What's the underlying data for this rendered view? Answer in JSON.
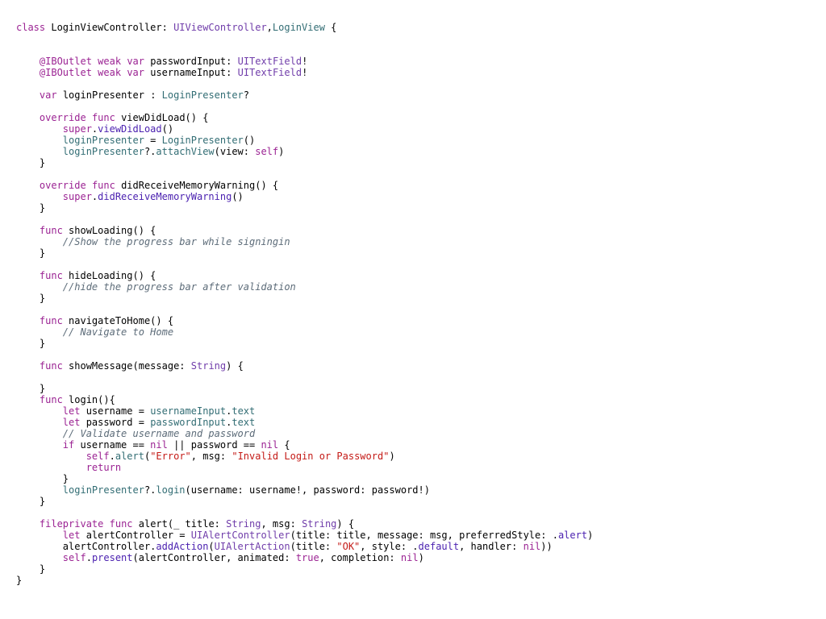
{
  "code": {
    "language": "Swift",
    "lines": [
      [
        [
          "kw",
          "class"
        ],
        [
          "plain",
          " LoginViewController: "
        ],
        [
          "type",
          "UIViewController"
        ],
        [
          "plain",
          ","
        ],
        [
          "ident",
          "LoginView"
        ],
        [
          "plain",
          " {"
        ]
      ],
      [],
      [],
      [
        [
          "plain",
          "    "
        ],
        [
          "attr",
          "@IBOutlet"
        ],
        [
          "plain",
          " "
        ],
        [
          "kw",
          "weak"
        ],
        [
          "plain",
          " "
        ],
        [
          "kw",
          "var"
        ],
        [
          "plain",
          " passwordInput: "
        ],
        [
          "type",
          "UITextField"
        ],
        [
          "plain",
          "!"
        ]
      ],
      [
        [
          "plain",
          "    "
        ],
        [
          "attr",
          "@IBOutlet"
        ],
        [
          "plain",
          " "
        ],
        [
          "kw",
          "weak"
        ],
        [
          "plain",
          " "
        ],
        [
          "kw",
          "var"
        ],
        [
          "plain",
          " usernameInput: "
        ],
        [
          "type",
          "UITextField"
        ],
        [
          "plain",
          "!"
        ]
      ],
      [],
      [
        [
          "plain",
          "    "
        ],
        [
          "kw",
          "var"
        ],
        [
          "plain",
          " loginPresenter : "
        ],
        [
          "ident",
          "LoginPresenter"
        ],
        [
          "plain",
          "?"
        ]
      ],
      [],
      [
        [
          "plain",
          "    "
        ],
        [
          "kw",
          "override"
        ],
        [
          "plain",
          " "
        ],
        [
          "kw",
          "func"
        ],
        [
          "plain",
          " viewDidLoad() {"
        ]
      ],
      [
        [
          "plain",
          "        "
        ],
        [
          "kw",
          "super"
        ],
        [
          "plain",
          "."
        ],
        [
          "call",
          "viewDidLoad"
        ],
        [
          "plain",
          "()"
        ]
      ],
      [
        [
          "plain",
          "        "
        ],
        [
          "ident",
          "loginPresenter"
        ],
        [
          "plain",
          " = "
        ],
        [
          "ident",
          "LoginPresenter"
        ],
        [
          "plain",
          "()"
        ]
      ],
      [
        [
          "plain",
          "        "
        ],
        [
          "ident",
          "loginPresenter"
        ],
        [
          "plain",
          "?."
        ],
        [
          "ident",
          "attachView"
        ],
        [
          "plain",
          "(view: "
        ],
        [
          "kw",
          "self"
        ],
        [
          "plain",
          ")"
        ]
      ],
      [
        [
          "plain",
          "    }"
        ]
      ],
      [],
      [
        [
          "plain",
          "    "
        ],
        [
          "kw",
          "override"
        ],
        [
          "plain",
          " "
        ],
        [
          "kw",
          "func"
        ],
        [
          "plain",
          " didReceiveMemoryWarning() {"
        ]
      ],
      [
        [
          "plain",
          "        "
        ],
        [
          "kw",
          "super"
        ],
        [
          "plain",
          "."
        ],
        [
          "call",
          "didReceiveMemoryWarning"
        ],
        [
          "plain",
          "()"
        ]
      ],
      [
        [
          "plain",
          "    }"
        ]
      ],
      [],
      [
        [
          "plain",
          "    "
        ],
        [
          "kw",
          "func"
        ],
        [
          "plain",
          " showLoading() {"
        ]
      ],
      [
        [
          "plain",
          "        "
        ],
        [
          "comment",
          "//Show the progress bar while signingin"
        ]
      ],
      [
        [
          "plain",
          "    }"
        ]
      ],
      [],
      [
        [
          "plain",
          "    "
        ],
        [
          "kw",
          "func"
        ],
        [
          "plain",
          " hideLoading() {"
        ]
      ],
      [
        [
          "plain",
          "        "
        ],
        [
          "comment",
          "//hide the progress bar after validation"
        ]
      ],
      [
        [
          "plain",
          "    }"
        ]
      ],
      [],
      [
        [
          "plain",
          "    "
        ],
        [
          "kw",
          "func"
        ],
        [
          "plain",
          " navigateToHome() {"
        ]
      ],
      [
        [
          "plain",
          "        "
        ],
        [
          "comment",
          "// Navigate to Home"
        ]
      ],
      [
        [
          "plain",
          "    }"
        ]
      ],
      [],
      [
        [
          "plain",
          "    "
        ],
        [
          "kw",
          "func"
        ],
        [
          "plain",
          " showMessage(message: "
        ],
        [
          "type",
          "String"
        ],
        [
          "plain",
          ") {"
        ]
      ],
      [],
      [
        [
          "plain",
          "    }"
        ]
      ],
      [
        [
          "plain",
          "    "
        ],
        [
          "kw",
          "func"
        ],
        [
          "plain",
          " login(){"
        ]
      ],
      [
        [
          "plain",
          "        "
        ],
        [
          "kw",
          "let"
        ],
        [
          "plain",
          " username = "
        ],
        [
          "ident",
          "usernameInput"
        ],
        [
          "plain",
          "."
        ],
        [
          "ident",
          "text"
        ]
      ],
      [
        [
          "plain",
          "        "
        ],
        [
          "kw",
          "let"
        ],
        [
          "plain",
          " password = "
        ],
        [
          "ident",
          "passwordInput"
        ],
        [
          "plain",
          "."
        ],
        [
          "ident",
          "text"
        ]
      ],
      [
        [
          "plain",
          "        "
        ],
        [
          "comment",
          "// Validate username and password"
        ]
      ],
      [
        [
          "plain",
          "        "
        ],
        [
          "kw",
          "if"
        ],
        [
          "plain",
          " username == "
        ],
        [
          "kw",
          "nil"
        ],
        [
          "plain",
          " || password == "
        ],
        [
          "kw",
          "nil"
        ],
        [
          "plain",
          " {"
        ]
      ],
      [
        [
          "plain",
          "            "
        ],
        [
          "kw",
          "self"
        ],
        [
          "plain",
          "."
        ],
        [
          "ident",
          "alert"
        ],
        [
          "plain",
          "("
        ],
        [
          "string",
          "\"Error\""
        ],
        [
          "plain",
          ", msg: "
        ],
        [
          "string",
          "\"Invalid Login or Password\""
        ],
        [
          "plain",
          ")"
        ]
      ],
      [
        [
          "plain",
          "            "
        ],
        [
          "kw",
          "return"
        ]
      ],
      [
        [
          "plain",
          "        }"
        ]
      ],
      [
        [
          "plain",
          "        "
        ],
        [
          "ident",
          "loginPresenter"
        ],
        [
          "plain",
          "?."
        ],
        [
          "ident",
          "login"
        ],
        [
          "plain",
          "(username: username!, password: password!)"
        ]
      ],
      [
        [
          "plain",
          "    }"
        ]
      ],
      [],
      [
        [
          "plain",
          "    "
        ],
        [
          "kw",
          "fileprivate"
        ],
        [
          "plain",
          " "
        ],
        [
          "kw",
          "func"
        ],
        [
          "plain",
          " alert(_ title: "
        ],
        [
          "type",
          "String"
        ],
        [
          "plain",
          ", msg: "
        ],
        [
          "type",
          "String"
        ],
        [
          "plain",
          ") {"
        ]
      ],
      [
        [
          "plain",
          "        "
        ],
        [
          "kw",
          "let"
        ],
        [
          "plain",
          " alertController = "
        ],
        [
          "type",
          "UIAlertController"
        ],
        [
          "plain",
          "(title: title, message: msg, preferredStyle: ."
        ],
        [
          "call",
          "alert"
        ],
        [
          "plain",
          ")"
        ]
      ],
      [
        [
          "plain",
          "        alertController."
        ],
        [
          "call",
          "addAction"
        ],
        [
          "plain",
          "("
        ],
        [
          "type",
          "UIAlertAction"
        ],
        [
          "plain",
          "(title: "
        ],
        [
          "string",
          "\"OK\""
        ],
        [
          "plain",
          ", style: ."
        ],
        [
          "call",
          "default"
        ],
        [
          "plain",
          ", handler: "
        ],
        [
          "kw",
          "nil"
        ],
        [
          "plain",
          "))"
        ]
      ],
      [
        [
          "plain",
          "        "
        ],
        [
          "kw",
          "self"
        ],
        [
          "plain",
          "."
        ],
        [
          "call",
          "present"
        ],
        [
          "plain",
          "(alertController, animated: "
        ],
        [
          "kw",
          "true"
        ],
        [
          "plain",
          ", completion: "
        ],
        [
          "kw",
          "nil"
        ],
        [
          "plain",
          ")"
        ]
      ],
      [
        [
          "plain",
          "    }"
        ]
      ],
      [
        [
          "plain",
          "}"
        ]
      ]
    ]
  },
  "colors": {
    "background": "#ffffff",
    "keyword": "#9b2393",
    "type": "#703daa",
    "project_identifier": "#326d74",
    "method_call": "#4b21b0",
    "comment": "#5d6c79",
    "string": "#c41a16",
    "plain": "#000000"
  }
}
